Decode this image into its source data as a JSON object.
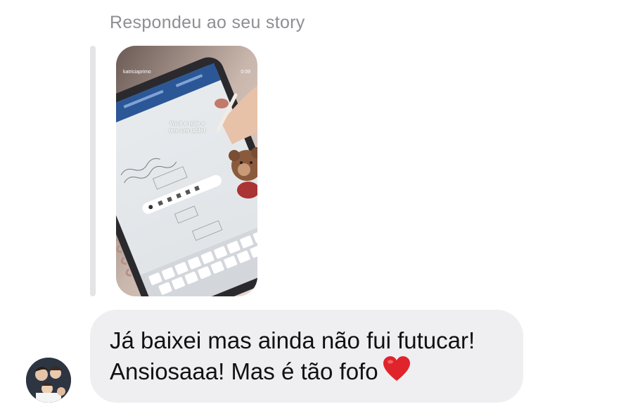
{
  "reply_context": {
    "label": "Respondeu ao seu story"
  },
  "story": {
    "username": "katriciaprimo",
    "duration": "0:09",
    "caption_line1": "Você é mãe e",
    "caption_line2": "tem um tablet"
  },
  "message": {
    "line1": "Já baixei mas ainda não fui futucar!",
    "line2": "Ansiosaaa! Mas é tão fofo",
    "emoji": "heart-emoji",
    "bubble_color": "#efeff2",
    "heart_color": "#e0242b"
  },
  "colors": {
    "label_gray": "#8e8e93",
    "quote_bar": "#e4e4e7",
    "text": "#111111"
  }
}
